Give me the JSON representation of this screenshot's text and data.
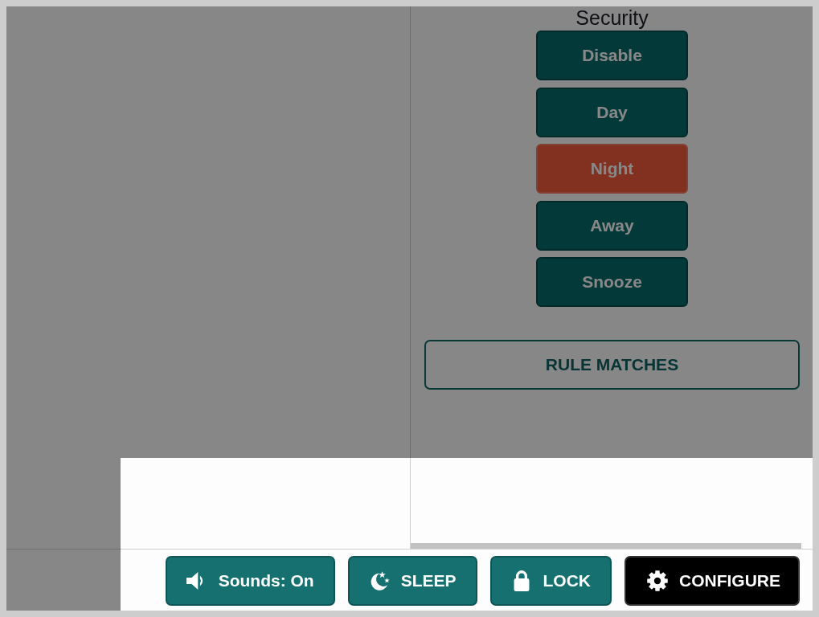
{
  "security_panel": {
    "title": "Security",
    "modes": [
      {
        "label": "Disable",
        "selected": false
      },
      {
        "label": "Day",
        "selected": false
      },
      {
        "label": "Night",
        "selected": true
      },
      {
        "label": "Away",
        "selected": false
      },
      {
        "label": "Snooze",
        "selected": false
      }
    ],
    "rule_matches_button": "RULE MATCHES"
  },
  "bottom_bar": {
    "buttons": [
      {
        "kind": "sounds",
        "label": "Sounds: On"
      },
      {
        "kind": "sleep",
        "label": "SLEEP"
      },
      {
        "kind": "lock",
        "label": "LOCK"
      },
      {
        "kind": "configure",
        "label": "CONFIGURE"
      }
    ]
  },
  "tour_overlay": {
    "shown": true
  }
}
